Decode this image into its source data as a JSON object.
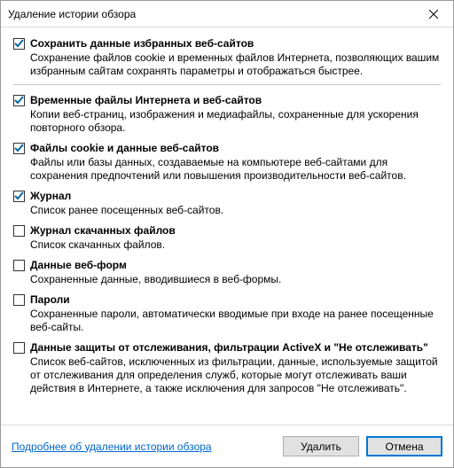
{
  "window": {
    "title": "Удаление истории обзора"
  },
  "items": [
    {
      "checked": true,
      "label": "Сохранить данные избранных веб-сайтов",
      "desc": "Сохранение файлов cookie и временных файлов Интернета, позволяющих вашим избранным сайтам сохранять параметры и отображаться быстрее.",
      "sep_after": true
    },
    {
      "checked": true,
      "label": "Временные файлы Интернета и веб-сайтов",
      "desc": "Копии веб-страниц, изображения и медиафайлы, сохраненные для ускорения повторного обзора."
    },
    {
      "checked": true,
      "label": "Файлы cookie и данные веб-сайтов",
      "desc": "Файлы или базы данных, создаваемые на компьютере веб-сайтами для сохранения предпочтений или повышения производительности веб-сайтов."
    },
    {
      "checked": true,
      "label": "Журнал",
      "desc": "Список ранее посещенных веб-сайтов."
    },
    {
      "checked": false,
      "label": "Журнал скачанных файлов",
      "desc": "Список скачанных файлов."
    },
    {
      "checked": false,
      "label": "Данные веб-форм",
      "desc": "Сохраненные данные, вводившиеся в веб-формы."
    },
    {
      "checked": false,
      "label": "Пароли",
      "desc": "Сохраненные пароли, автоматически вводимые при входе на ранее посещенные веб-сайты."
    },
    {
      "checked": false,
      "label": "Данные защиты от отслеживания, фильтрации ActiveX и \"Не отслеживать\"",
      "desc": "Список веб-сайтов, исключенных из фильтрации, данные, используемые защитой от отслеживания для определения служб, которые могут отслеживать ваши действия в Интернете, а также исключения для запросов \"Не отслеживать\"."
    }
  ],
  "footer": {
    "link": "Подробнее об удалении истории обзора",
    "delete": "Удалить",
    "cancel": "Отмена"
  }
}
